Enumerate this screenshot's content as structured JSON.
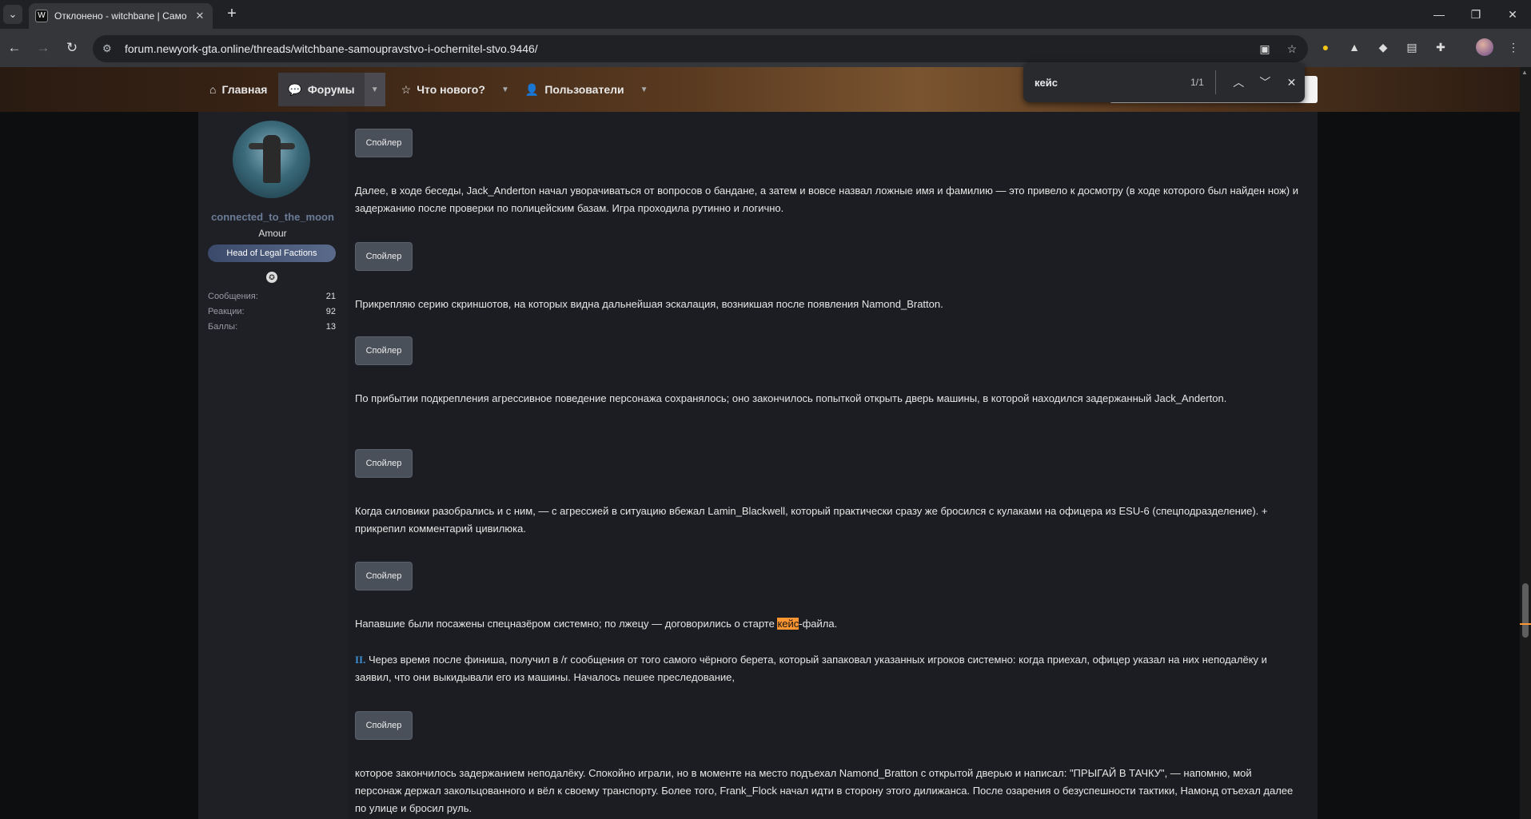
{
  "browser": {
    "tab_title": "Отклонено - witchbane | Само",
    "tab_favicon": "W",
    "url": "forum.newyork-gta.online/threads/witchbane-samoupravstvo-i-ochernitel-stvo.9446/",
    "extension_badge": "1"
  },
  "nav": {
    "home": "Главная",
    "forums": "Форумы",
    "whats_new": "Что нового?",
    "members": "Пользователи"
  },
  "find": {
    "query": "кейс",
    "count": "1/1"
  },
  "user": {
    "name": "connected_to_the_moon",
    "title": "Amour",
    "banner": "Head of Legal Factions",
    "stats": [
      {
        "label": "Сообщения:",
        "value": "21"
      },
      {
        "label": "Реакции:",
        "value": "92"
      },
      {
        "label": "Баллы:",
        "value": "13"
      }
    ]
  },
  "post": {
    "spoiler_label": "Спойлер",
    "p1": "Далее, в ходе беседы, Jack_Anderton начал уворачиваться от вопросов о бандане, а затем и вовсе назвал ложные имя и фамилию — это привело к досмотру (в ходе которого был найден нож) и задержанию после проверки по полицейским базам. Игра проходила рутинно и логично.",
    "p2": "Прикрепляю серию скриншотов, на которых видна дальнейшая эскалация, возникшая после появления Namond_Bratton.",
    "p3": "По прибытии подкрепления агрессивное поведение персонажа сохранялось; оно закончилось попыткой открыть дверь машины, в которой находился задержанный Jack_Anderton.",
    "p4": "Когда силовики разобрались и с ним, — с агрессией в ситуацию вбежал Lamin_Blackwell, который практически сразу же бросился с кулаками на офицера из ESU-6 (спецподразделение). + прикрепил комментарий цивилюка.",
    "p5_before": "Напавшие были посажены спецназёром системно; по лжецу — договорились о старте ",
    "p5_highlight": "кейс",
    "p5_after": "-файла.",
    "p6_roman": "II.",
    "p6": " Через время после финиша, получил в /r сообщения от того самого чёрного берета, который запаковал указанных игроков системно: когда приехал, офицер указал на них неподалёку и заявил, что они выкидывали его из машины. Началось пешее преследование,",
    "p7": "которое закончилось задержанием неподалёку. Спокойно играли, но в моменте на место подъехал Namond_Bratton с открытой дверью и написал: \"ПРЫГАЙ В ТАЧКУ\", — напомню, мой персонаж держал закольцованного и вёл к своему транспорту. Более того, Frank_Flock начал идти в сторону этого дилижанса. После озарения о безуспешности тактики, Намонд отъехал далее по улице и бросил руль."
  },
  "colors": {
    "highlight": "#ff9632",
    "username": "#6a7c96",
    "roman_accent": "#3d8fd1"
  }
}
